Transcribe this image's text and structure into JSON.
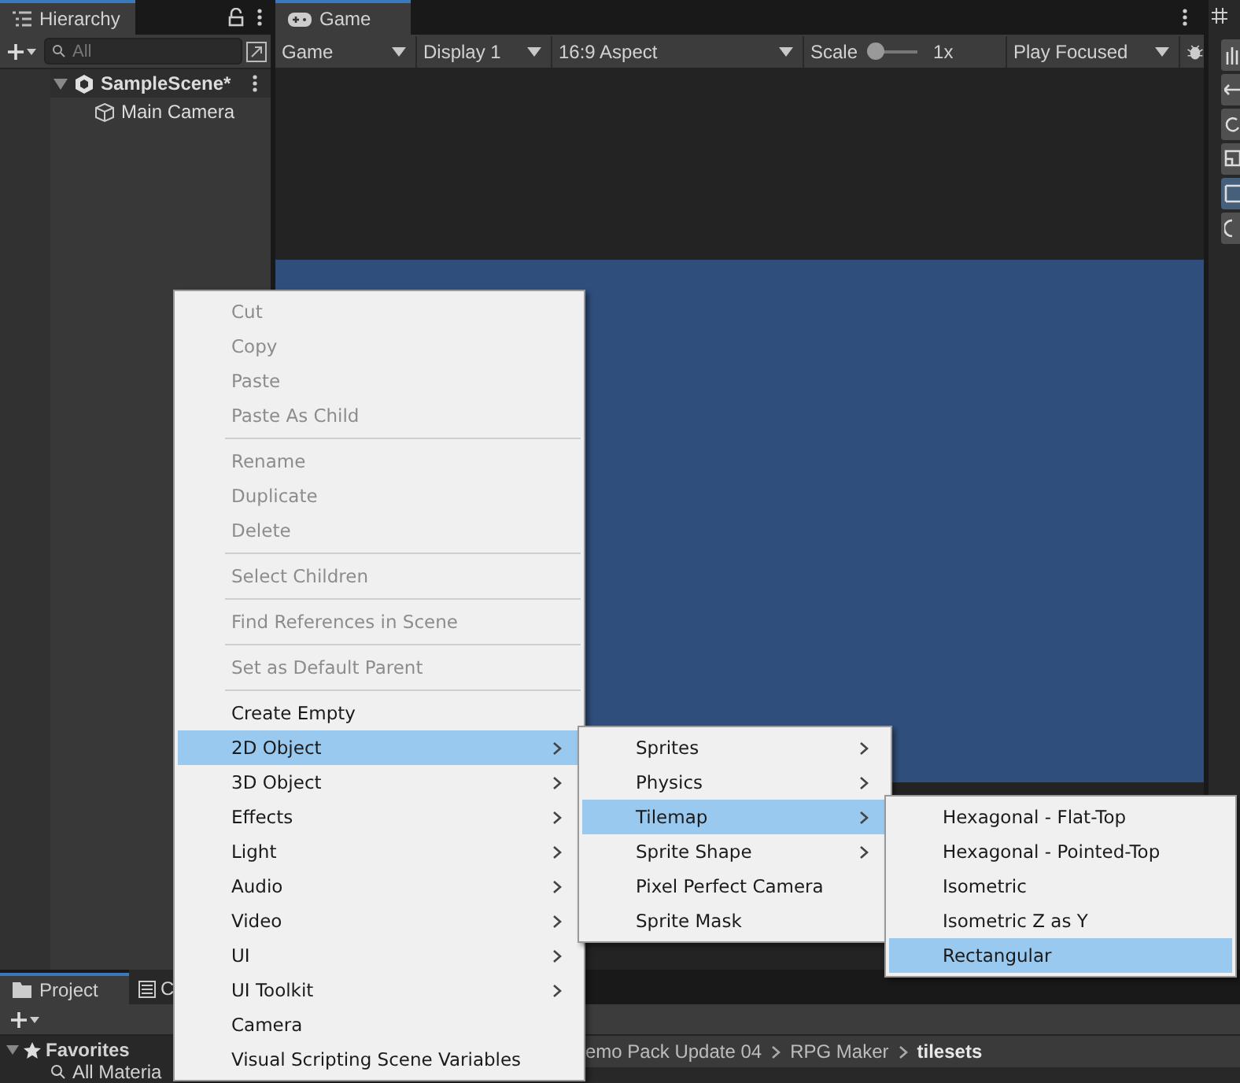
{
  "hierarchy": {
    "title": "Hierarchy",
    "search": {
      "placeholder": "All"
    },
    "scene": {
      "name": "SampleScene*",
      "expanded": true,
      "children": [
        {
          "name": "Main Camera"
        }
      ]
    }
  },
  "game": {
    "tab": "Game",
    "toolbar": {
      "view": "Game",
      "display": "Display 1",
      "aspect": "16:9 Aspect",
      "scale_label": "Scale",
      "scale": {
        "level": 0
      },
      "scale_value": "1x",
      "play_mode": "Play Focused"
    }
  },
  "context_menu": [
    {
      "kind": "item",
      "label": "Cut",
      "disabled": true,
      "submenu": false,
      "selected": false
    },
    {
      "kind": "item",
      "label": "Copy",
      "disabled": true,
      "submenu": false,
      "selected": false
    },
    {
      "kind": "item",
      "label": "Paste",
      "disabled": true,
      "submenu": false,
      "selected": false
    },
    {
      "kind": "item",
      "label": "Paste As Child",
      "disabled": true,
      "submenu": false,
      "selected": false
    },
    {
      "kind": "separator"
    },
    {
      "kind": "item",
      "label": "Rename",
      "disabled": true,
      "submenu": false,
      "selected": false
    },
    {
      "kind": "item",
      "label": "Duplicate",
      "disabled": true,
      "submenu": false,
      "selected": false
    },
    {
      "kind": "item",
      "label": "Delete",
      "disabled": true,
      "submenu": false,
      "selected": false
    },
    {
      "kind": "separator"
    },
    {
      "kind": "item",
      "label": "Select Children",
      "disabled": true,
      "submenu": false,
      "selected": false
    },
    {
      "kind": "separator"
    },
    {
      "kind": "item",
      "label": "Find References in Scene",
      "disabled": true,
      "submenu": false,
      "selected": false
    },
    {
      "kind": "separator"
    },
    {
      "kind": "item",
      "label": "Set as Default Parent",
      "disabled": true,
      "submenu": false,
      "selected": false
    },
    {
      "kind": "separator"
    },
    {
      "kind": "item",
      "label": "Create Empty",
      "disabled": false,
      "submenu": false,
      "selected": false
    },
    {
      "kind": "item",
      "label": "2D Object",
      "disabled": false,
      "submenu": true,
      "selected": true
    },
    {
      "kind": "item",
      "label": "3D Object",
      "disabled": false,
      "submenu": true,
      "selected": false
    },
    {
      "kind": "item",
      "label": "Effects",
      "disabled": false,
      "submenu": true,
      "selected": false
    },
    {
      "kind": "item",
      "label": "Light",
      "disabled": false,
      "submenu": true,
      "selected": false
    },
    {
      "kind": "item",
      "label": "Audio",
      "disabled": false,
      "submenu": true,
      "selected": false
    },
    {
      "kind": "item",
      "label": "Video",
      "disabled": false,
      "submenu": true,
      "selected": false
    },
    {
      "kind": "item",
      "label": "UI",
      "disabled": false,
      "submenu": true,
      "selected": false
    },
    {
      "kind": "item",
      "label": "UI Toolkit",
      "disabled": false,
      "submenu": true,
      "selected": false
    },
    {
      "kind": "item",
      "label": "Camera",
      "disabled": false,
      "submenu": false,
      "selected": false
    },
    {
      "kind": "item",
      "label": "Visual Scripting Scene Variables",
      "disabled": false,
      "submenu": false,
      "selected": false
    }
  ],
  "submenu_2d_object": [
    {
      "kind": "item",
      "label": "Sprites",
      "disabled": false,
      "submenu": true,
      "selected": false
    },
    {
      "kind": "item",
      "label": "Physics",
      "disabled": false,
      "submenu": true,
      "selected": false
    },
    {
      "kind": "item",
      "label": "Tilemap",
      "disabled": false,
      "submenu": true,
      "selected": true
    },
    {
      "kind": "item",
      "label": "Sprite Shape",
      "disabled": false,
      "submenu": true,
      "selected": false
    },
    {
      "kind": "item",
      "label": "Pixel Perfect Camera",
      "disabled": false,
      "submenu": false,
      "selected": false
    },
    {
      "kind": "item",
      "label": "Sprite Mask",
      "disabled": false,
      "submenu": false,
      "selected": false
    }
  ],
  "submenu_tilemap": [
    {
      "kind": "item",
      "label": "Hexagonal - Flat-Top",
      "disabled": false,
      "submenu": false,
      "selected": false
    },
    {
      "kind": "item",
      "label": "Hexagonal - Pointed-Top",
      "disabled": false,
      "submenu": false,
      "selected": false
    },
    {
      "kind": "item",
      "label": "Isometric",
      "disabled": false,
      "submenu": false,
      "selected": false
    },
    {
      "kind": "item",
      "label": "Isometric Z as Y",
      "disabled": false,
      "submenu": false,
      "selected": false
    },
    {
      "kind": "item",
      "label": "Rectangular",
      "disabled": false,
      "submenu": false,
      "selected": true
    }
  ],
  "project": {
    "tabs": [
      {
        "label": "Project",
        "selected": true
      },
      {
        "label": "C",
        "selected": false
      }
    ],
    "favorites": "Favorites",
    "favorite_items": [
      "All Materia"
    ],
    "breadcrumb": [
      "emo Pack Update 04",
      "RPG Maker",
      "tilesets"
    ]
  }
}
